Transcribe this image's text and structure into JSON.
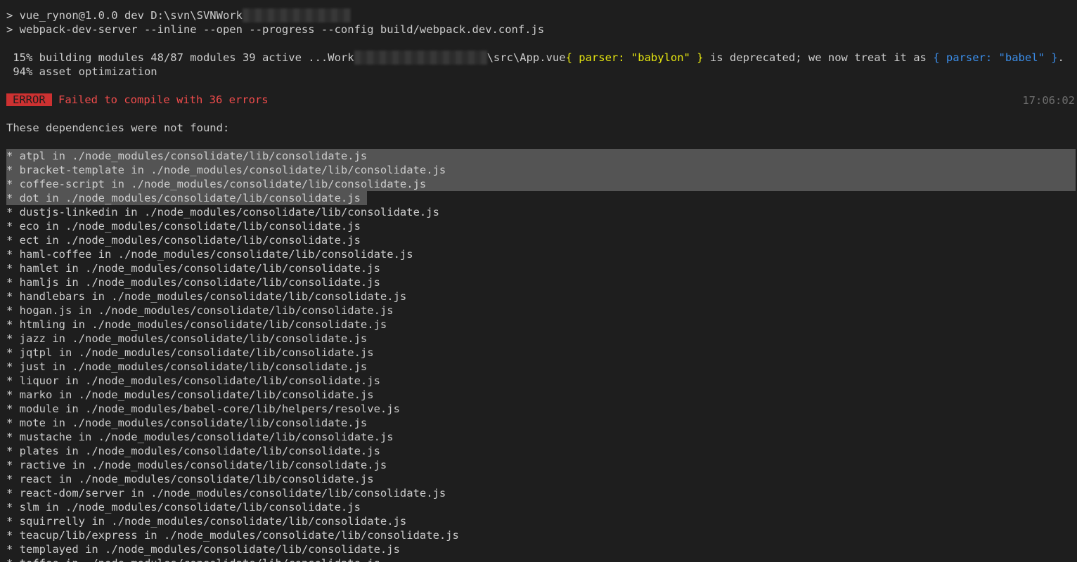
{
  "header": {
    "line1_prefix": "> vue_rynon@1.0.0 dev D:\\svn\\SVNWork",
    "line2": "> webpack-dev-server --inline --open --progress --config build/webpack.dev.conf.js"
  },
  "progress": {
    "line1_prefix": " 15% building modules 48/87 modules 39 active ...Work",
    "line1_path_suffix": "\\src\\App.vue",
    "parser_old_open": "{ ",
    "parser_old_key": "parser: ",
    "parser_old_value": "\"babylon\"",
    "parser_old_close": " }",
    "deprecation_text": " is deprecated; we now treat it as ",
    "parser_new_open": "{ ",
    "parser_new_key": "parser: ",
    "parser_new_value": "\"babel\"",
    "parser_new_close": " }",
    "deprecation_end": ".",
    "line2": " 94% asset optimization"
  },
  "error": {
    "badge": "ERROR",
    "message": "Failed to compile with 36 errors",
    "timestamp": "17:06:02"
  },
  "deps_heading": "These dependencies were not found:",
  "dependencies": [
    "* atpl in ./node_modules/consolidate/lib/consolidate.js",
    "* bracket-template in ./node_modules/consolidate/lib/consolidate.js",
    "* coffee-script in ./node_modules/consolidate/lib/consolidate.js",
    "* dot in ./node_modules/consolidate/lib/consolidate.js",
    "* dustjs-linkedin in ./node_modules/consolidate/lib/consolidate.js",
    "* eco in ./node_modules/consolidate/lib/consolidate.js",
    "* ect in ./node_modules/consolidate/lib/consolidate.js",
    "* haml-coffee in ./node_modules/consolidate/lib/consolidate.js",
    "* hamlet in ./node_modules/consolidate/lib/consolidate.js",
    "* hamljs in ./node_modules/consolidate/lib/consolidate.js",
    "* handlebars in ./node_modules/consolidate/lib/consolidate.js",
    "* hogan.js in ./node_modules/consolidate/lib/consolidate.js",
    "* htmling in ./node_modules/consolidate/lib/consolidate.js",
    "* jazz in ./node_modules/consolidate/lib/consolidate.js",
    "* jqtpl in ./node_modules/consolidate/lib/consolidate.js",
    "* just in ./node_modules/consolidate/lib/consolidate.js",
    "* liquor in ./node_modules/consolidate/lib/consolidate.js",
    "* marko in ./node_modules/consolidate/lib/consolidate.js",
    "* module in ./node_modules/babel-core/lib/helpers/resolve.js",
    "* mote in ./node_modules/consolidate/lib/consolidate.js",
    "* mustache in ./node_modules/consolidate/lib/consolidate.js",
    "* plates in ./node_modules/consolidate/lib/consolidate.js",
    "* ractive in ./node_modules/consolidate/lib/consolidate.js",
    "* react in ./node_modules/consolidate/lib/consolidate.js",
    "* react-dom/server in ./node_modules/consolidate/lib/consolidate.js",
    "* slm in ./node_modules/consolidate/lib/consolidate.js",
    "* squirrelly in ./node_modules/consolidate/lib/consolidate.js",
    "* teacup/lib/express in ./node_modules/consolidate/lib/consolidate.js",
    "* templayed in ./node_modules/consolidate/lib/consolidate.js",
    "* toffee in ./node_modules/consolidate/lib/consolidate.js"
  ],
  "selection": {
    "selected_line_count": 4
  },
  "colors": {
    "background": "#1e1e1e",
    "foreground": "#cccccc",
    "error_badge": "#cd3131",
    "error_text": "#f14c4c",
    "yellow": "#e5e510",
    "blue": "#3b8eea",
    "selection": "#545454"
  }
}
